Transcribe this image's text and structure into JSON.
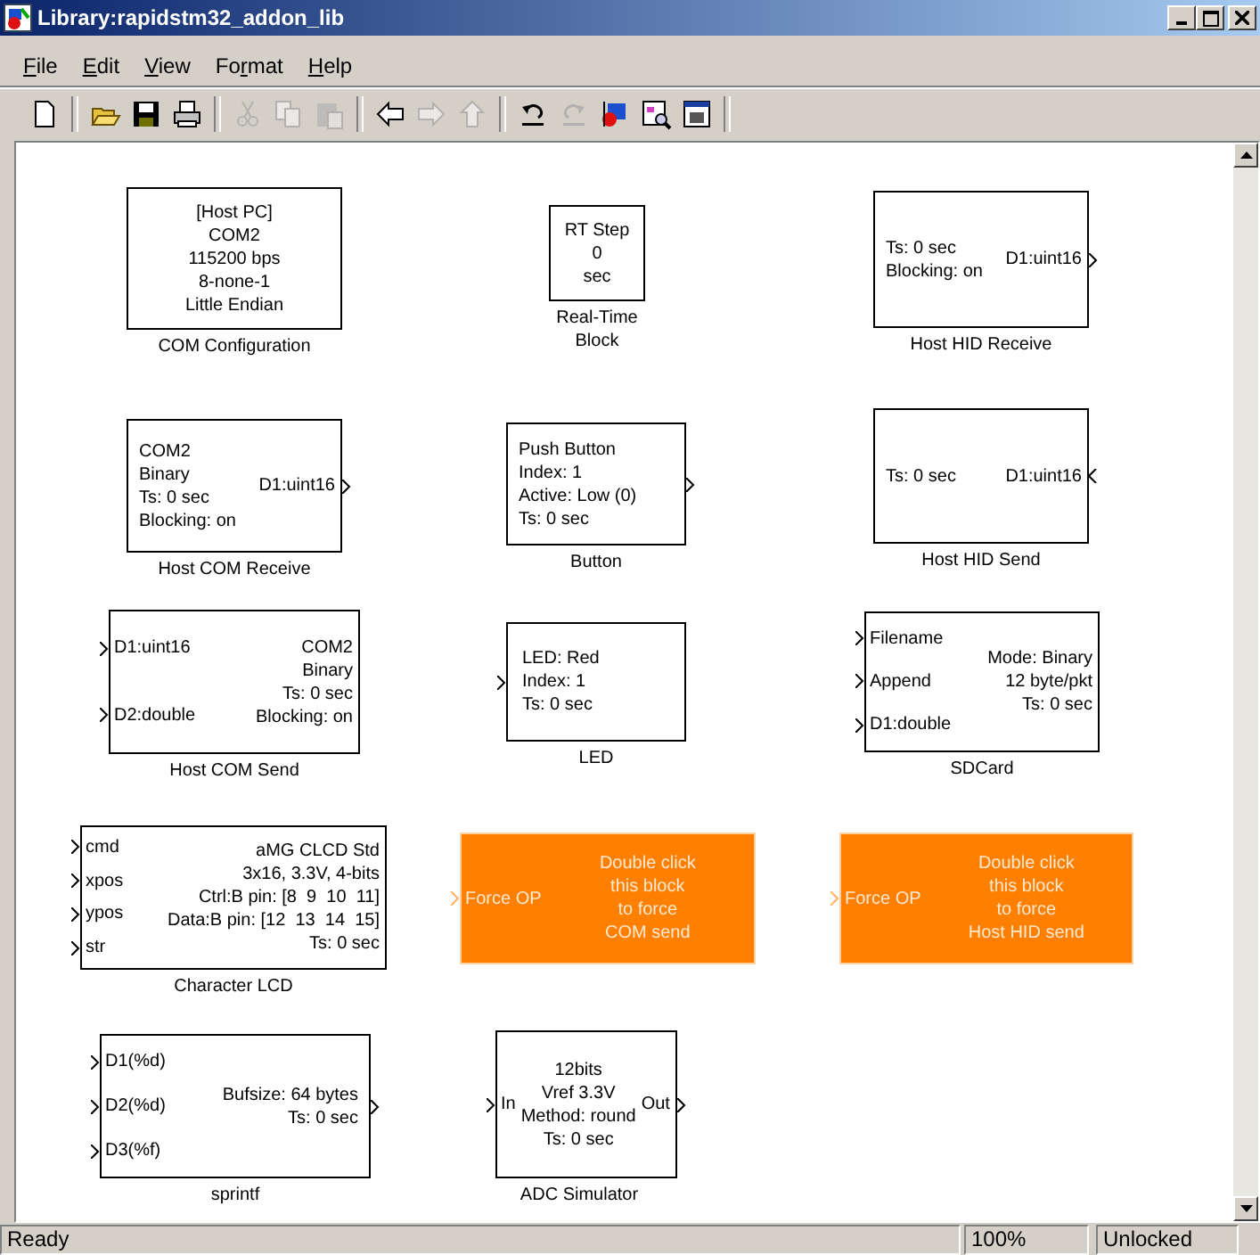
{
  "window": {
    "title": "Library:rapidstm32_addon_lib"
  },
  "menu": [
    {
      "key": "F",
      "rest": "ile"
    },
    {
      "key": "E",
      "rest": "dit"
    },
    {
      "key": "V",
      "rest": "iew"
    },
    {
      "lead": "Fo",
      "key": "r",
      "rest": "mat"
    },
    {
      "key": "H",
      "rest": "elp"
    }
  ],
  "toolbar": [
    {
      "kind": "new",
      "disabled": false
    },
    {
      "kind": "separator"
    },
    {
      "kind": "open",
      "disabled": false
    },
    {
      "kind": "save",
      "disabled": false
    },
    {
      "kind": "print",
      "disabled": false
    },
    {
      "kind": "separator"
    },
    {
      "kind": "cut",
      "disabled": true
    },
    {
      "kind": "copy",
      "disabled": true
    },
    {
      "kind": "paste",
      "disabled": true
    },
    {
      "kind": "separator"
    },
    {
      "kind": "back",
      "disabled": false
    },
    {
      "kind": "forward",
      "disabled": true
    },
    {
      "kind": "up",
      "disabled": true
    },
    {
      "kind": "separator"
    },
    {
      "kind": "undo",
      "disabled": false
    },
    {
      "kind": "redo",
      "disabled": true
    },
    {
      "kind": "library",
      "disabled": false
    },
    {
      "kind": "explorer",
      "disabled": false
    },
    {
      "kind": "debugger",
      "disabled": false
    },
    {
      "kind": "separator"
    }
  ],
  "blocks": [
    {
      "kind": "plain",
      "name": "COM Configuration",
      "lines": [
        "[Host PC]",
        "COM2",
        "115200 bps",
        "8-none-1",
        "Little Endian"
      ]
    },
    {
      "kind": "plain",
      "name": "Real-Time Block",
      "lines": [
        "RT Step",
        "0",
        "sec"
      ]
    },
    {
      "kind": "plain",
      "name": "Host HID Receive",
      "lines": [
        "Ts: 0 sec",
        "Blocking: on"
      ],
      "output": "D1:uint16"
    },
    {
      "kind": "plain",
      "name": "Host COM Receive",
      "lines": [
        "COM2",
        "Binary",
        "Ts: 0 sec",
        "Blocking: on"
      ],
      "output": "D1:uint16"
    },
    {
      "kind": "plain",
      "name": "Button",
      "lines": [
        "Push Button",
        "Index: 1",
        "Active: Low (0)",
        "Ts: 0 sec"
      ],
      "output_port": true
    },
    {
      "kind": "plain",
      "name": "Host HID Send",
      "lines": [
        "Ts: 0 sec"
      ],
      "right_input": "D1:uint16"
    },
    {
      "kind": "plain",
      "name": "Host COM Send",
      "inputs": [
        "D1:uint16",
        "D2:double"
      ],
      "lines": [
        "COM2",
        "Binary",
        "Ts: 0 sec",
        "Blocking: on"
      ]
    },
    {
      "kind": "plain",
      "name": "LED",
      "input_port": true,
      "lines": [
        "LED: Red",
        "Index: 1",
        "Ts: 0 sec"
      ]
    },
    {
      "kind": "plain",
      "name": "SDCard",
      "inputs": [
        "Filename",
        "Append",
        "D1:double"
      ],
      "lines": [
        "Mode: Binary",
        "12 byte/pkt",
        "Ts: 0 sec"
      ]
    },
    {
      "kind": "plain",
      "name": "Character LCD",
      "inputs": [
        "cmd",
        "xpos",
        "ypos",
        "str"
      ],
      "lines": [
        "aMG CLCD Std",
        "3x16, 3.3V, 4-bits",
        "Ctrl:B pin: [8  9  10  11]",
        "Data:B pin: [12  13  14  15]",
        "Ts: 0 sec"
      ]
    },
    {
      "kind": "orange",
      "inputs": [
        "Force OP"
      ],
      "lines": [
        "Double click",
        "this block",
        "to force",
        "COM send"
      ]
    },
    {
      "kind": "orange",
      "inputs": [
        "Force OP"
      ],
      "lines": [
        "Double click",
        "this block",
        "to force",
        "Host HID send"
      ]
    },
    {
      "kind": "plain",
      "name": "sprintf",
      "inputs": [
        "D1(%d)",
        "D2(%d)",
        "D3(%f)"
      ],
      "lines": [
        "Bufsize: 64 bytes",
        "Ts: 0 sec"
      ],
      "output_port": true
    },
    {
      "kind": "plain",
      "name": "ADC Simulator",
      "inputs": [
        "In"
      ],
      "lines": [
        "12bits",
        "Vref 3.3V",
        "Method: round",
        "Ts: 0 sec"
      ],
      "output": "Out"
    }
  ],
  "status_bar": {
    "message": "Ready",
    "zoom": "100%",
    "lock": "Unlocked"
  }
}
